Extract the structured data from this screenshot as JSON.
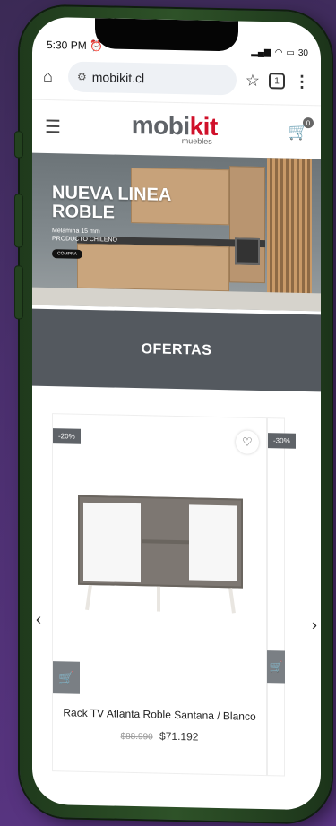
{
  "status": {
    "time": "5:30 PM",
    "alarm_icon": "alarm-icon",
    "battery": "30"
  },
  "browser": {
    "url": "mobikit.cl",
    "tab_count": "1"
  },
  "site": {
    "logo_main_a": "mobi",
    "logo_main_b": "kit",
    "logo_sub": "muebles",
    "cart_count": "0",
    "brand_color": "#d0102a"
  },
  "hero": {
    "title_line1": "NUEVA LINEA",
    "title_line2": "ROBLE",
    "sub_line1": "Melamina 15 mm",
    "sub_line2": "PRODUCTO CHILENO",
    "button": "COMPRA"
  },
  "ofertas": {
    "label": "OFERTAS"
  },
  "product": {
    "discount": "-20%",
    "name": "Rack TV Atlanta Roble Santana / Blanco",
    "old_price": "$88.990",
    "new_price": "$71.192"
  },
  "product_next": {
    "discount": "-30%"
  }
}
